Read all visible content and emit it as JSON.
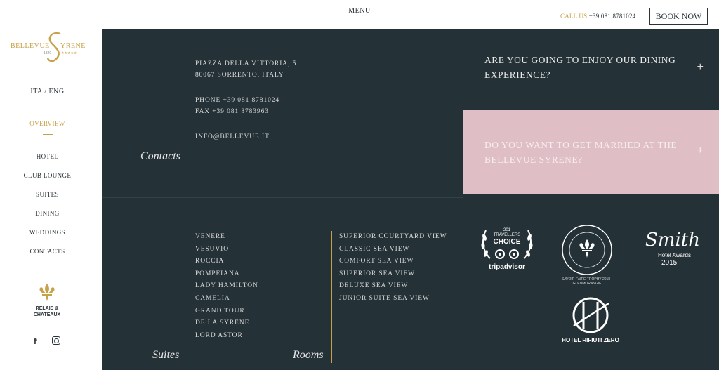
{
  "header": {
    "menu_label": "MENU",
    "call_label": "CALL US",
    "phone": "+39 081 8781024",
    "book_label": "BOOK NOW"
  },
  "sidebar": {
    "logo_text": "BELLEVUE SYRENE",
    "logo_year": "1820",
    "logo_stars": "★★★★★",
    "language": "ITA / ENG",
    "nav": [
      {
        "label": "OVERVIEW"
      },
      {
        "label": "HOTEL"
      },
      {
        "label": "CLUB LOUNGE"
      },
      {
        "label": "SUITES"
      },
      {
        "label": "DINING"
      },
      {
        "label": "WEDDINGS"
      },
      {
        "label": "CONTACTS"
      }
    ],
    "relais": {
      "line1": "RELAIS &",
      "line2": "CHATEAUX"
    },
    "social": {
      "facebook": "f"
    }
  },
  "contacts": {
    "title": "Contacts",
    "address1": "PIAZZA DELLA VITTORIA, 5",
    "address2": "80067 SORRENTO, ITALY",
    "phone": "PHONE +39 081 8781024",
    "fax": "FAX +39 081 8783963",
    "email": "INFO@BELLEVUE.IT"
  },
  "suites": {
    "title": "Suites",
    "items": [
      "VENERE",
      "VESUVIO",
      "ROCCIA",
      "POMPEIANA",
      "LADY HAMILTON",
      "CAMELIA",
      "GRAND TOUR",
      "DE LA SYRENE",
      "LORD ASTOR"
    ]
  },
  "rooms": {
    "title": "Rooms",
    "items": [
      "SUPERIOR COURTYARD VIEW",
      "CLASSIC SEA VIEW",
      "COMFORT SEA VIEW",
      "SUPERIOR SEA VIEW",
      "DELUXE SEA VIEW",
      "JUNIOR SUITE SEA VIEW"
    ]
  },
  "faq": [
    {
      "text": "ARE YOU GOING TO ENJOY OUR DINING EXPERIENCE?",
      "icon": "+"
    },
    {
      "text": "DO YOU WANT TO GET MARRIED AT THE BELLEVUE SYRENE?",
      "icon": "+"
    }
  ],
  "awards": {
    "tripadvisor": {
      "year": "201",
      "line1": "TRAVELLERS",
      "line2": "CHOICE",
      "brand": "tripadvisor"
    },
    "savoir": {
      "text": "SAVOIR-FAIRE TROPHY 2018 · GLENMORANGIE"
    },
    "smith": {
      "script": "Smith",
      "line1": "Hotel Awards",
      "year": "2015"
    },
    "rifiuti": {
      "label": "HOTEL RIFIUTI ZERO"
    }
  },
  "colors": {
    "dark": "#243136",
    "gold": "#c8a24a",
    "pink": "#dfbec6"
  }
}
